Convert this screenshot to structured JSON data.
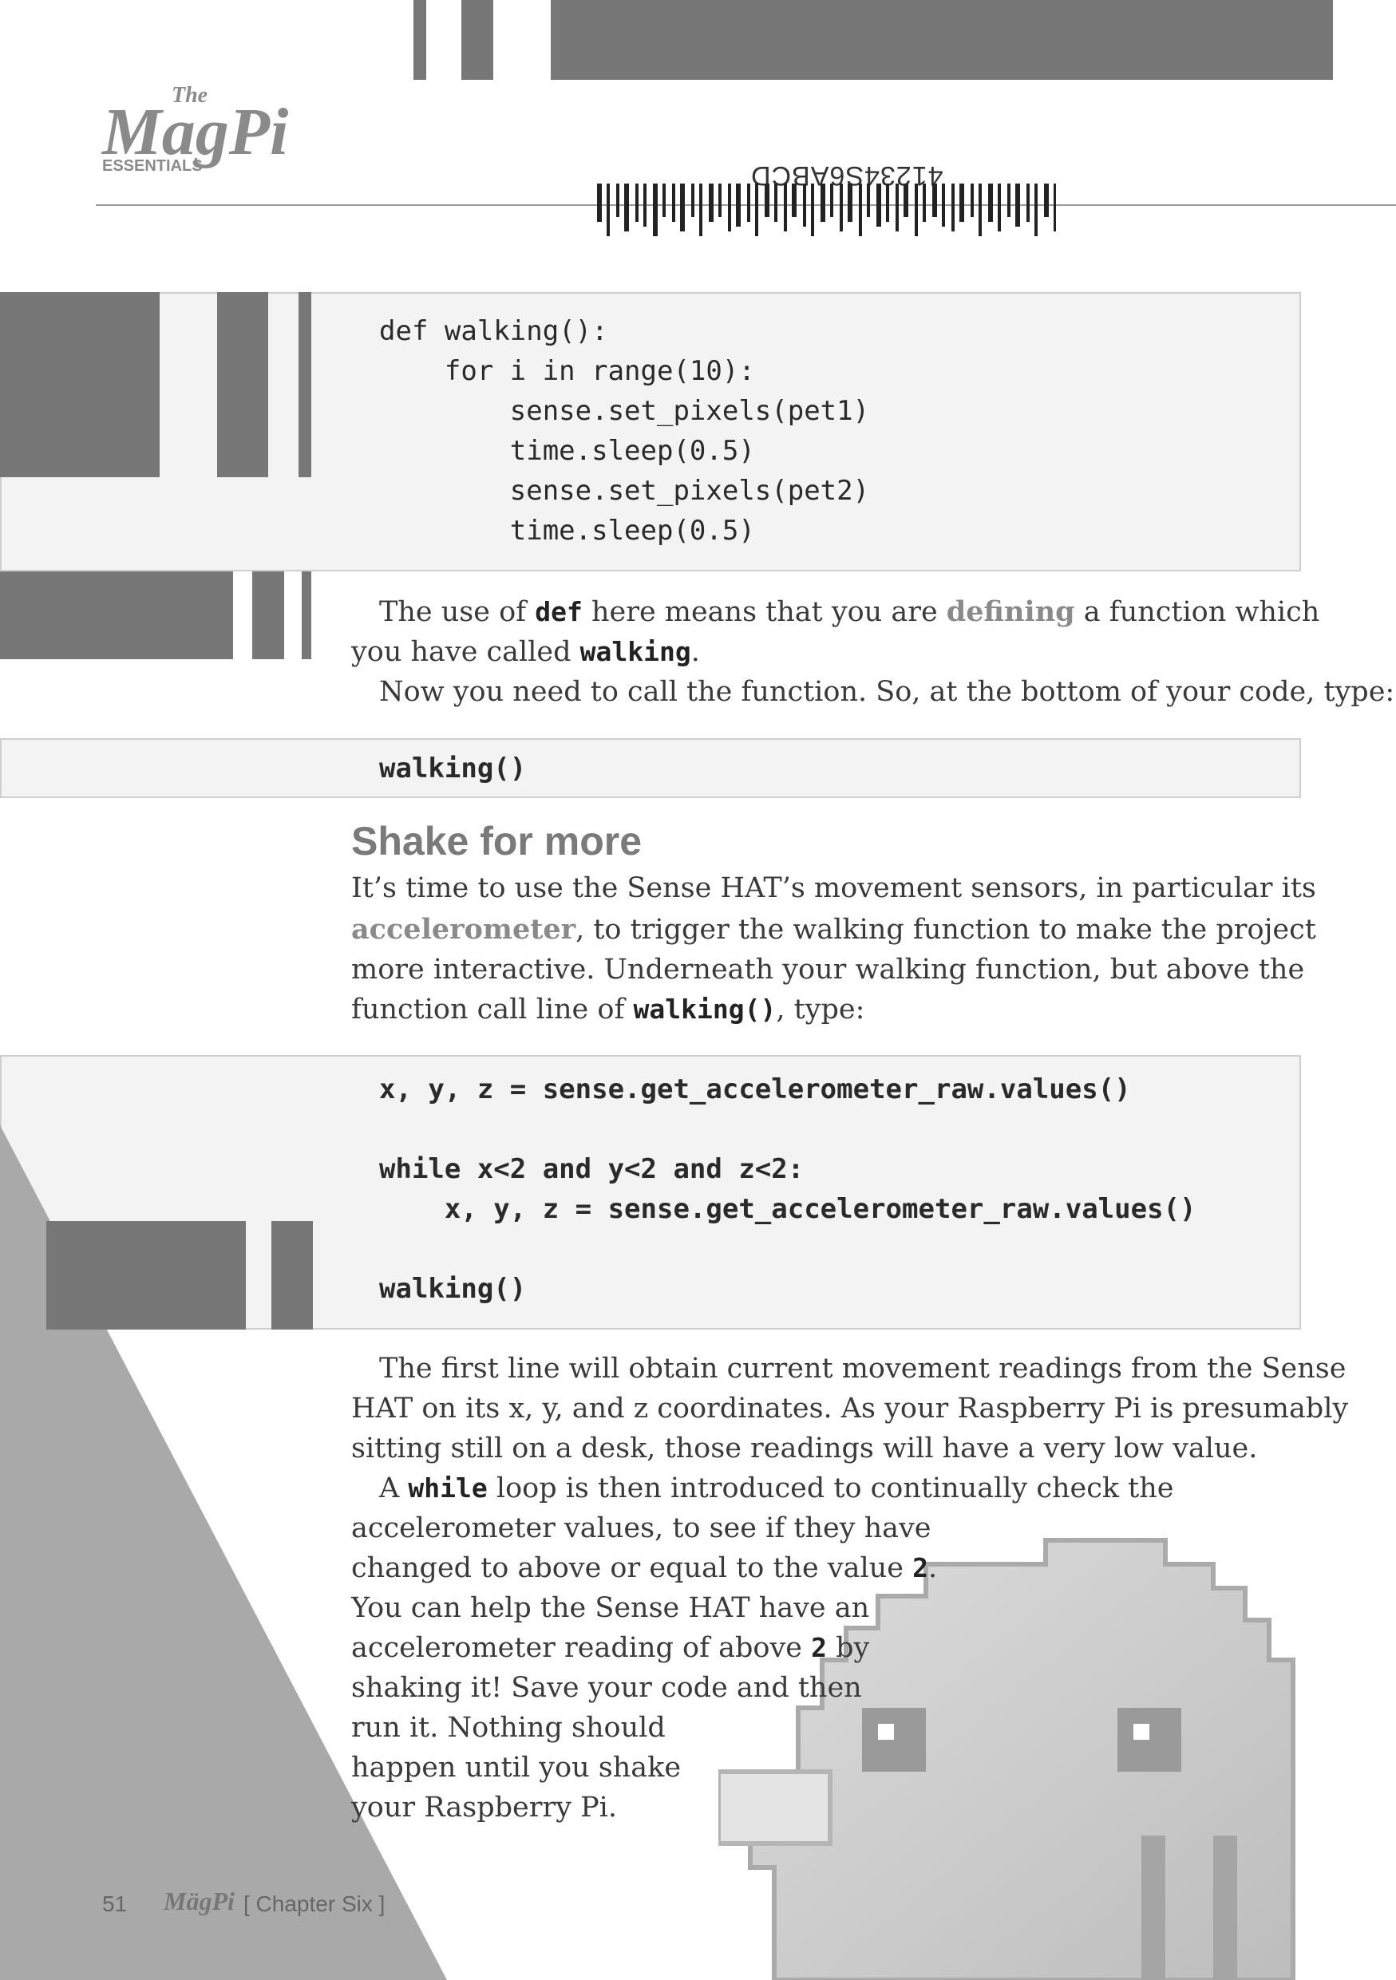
{
  "header": {
    "logo_the": "The",
    "logo_magpi": "MagPi",
    "logo_essentials": "ESSENTIALS",
    "barcode_text": "41234S6ABCD"
  },
  "code_block_1": {
    "lines": [
      "def walking():",
      "    for i in range(10):",
      "        sense.set_pixels(pet1)",
      "        time.sleep(0.5)",
      "        sense.set_pixels(pet2)",
      "        time.sleep(0.5)"
    ]
  },
  "para_1": {
    "line1_a": "The use of ",
    "line1_code": "def",
    "line1_b": " here means that you are ",
    "line1_hl": "defining",
    "line1_c": " a function which",
    "line2_a": "you have called ",
    "line2_code": "walking",
    "line2_b": "."
  },
  "para_2": {
    "line1": "Now you need to call the function. So, at the bottom of your code, type:"
  },
  "code_block_2": {
    "line": "walking()"
  },
  "heading": "Shake for more",
  "para_3": {
    "line1": "It’s time to use the Sense HAT’s movement sensors, in particular its",
    "line2_hl": "accelerometer",
    "line2_b": ", to trigger the walking function to make the project",
    "line3": "more interactive. Underneath your walking function, but above the",
    "line4_a": "function call line of ",
    "line4_code": "walking()",
    "line4_b": ", type:"
  },
  "code_block_3": {
    "lines": [
      "x, y, z = sense.get_accelerometer_raw.values()",
      "",
      "while x<2 and y<2 and z<2:",
      "    x, y, z = sense.get_accelerometer_raw.values()",
      "",
      "walking()"
    ]
  },
  "para_4": {
    "lines": [
      "The first line will obtain current movement readings from the Sense",
      "HAT on its x, y, and z coordinates. As your Raspberry Pi is presumably",
      "sitting still on a desk, those readings will have a very low value."
    ]
  },
  "para_5": {
    "line1_a": "A ",
    "line1_code": "while",
    "line1_b": " loop is then introduced to continually check the",
    "line2": "accelerometer values, to see if they have",
    "line3_a": "changed to above or equal to the value ",
    "line3_code": "2",
    "line3_b": ".",
    "line4": "You can help the Sense HAT have an",
    "line5_a": "accelerometer reading of above ",
    "line5_code": "2",
    "line5_b": " by",
    "line6": "shaking it! Save your code and then",
    "line7": "run it. Nothing should",
    "line8": "happen until you shake",
    "line9": "your Raspberry Pi."
  },
  "footer": {
    "page_number": "51",
    "logo": "MägPi",
    "chapter": "[ Chapter Six ]"
  },
  "colors": {
    "bar_dark": "#777777",
    "bar_mid": "#8a8a8a",
    "triangle": "#a9a9a9",
    "code_bg": "#f3f3f3"
  }
}
